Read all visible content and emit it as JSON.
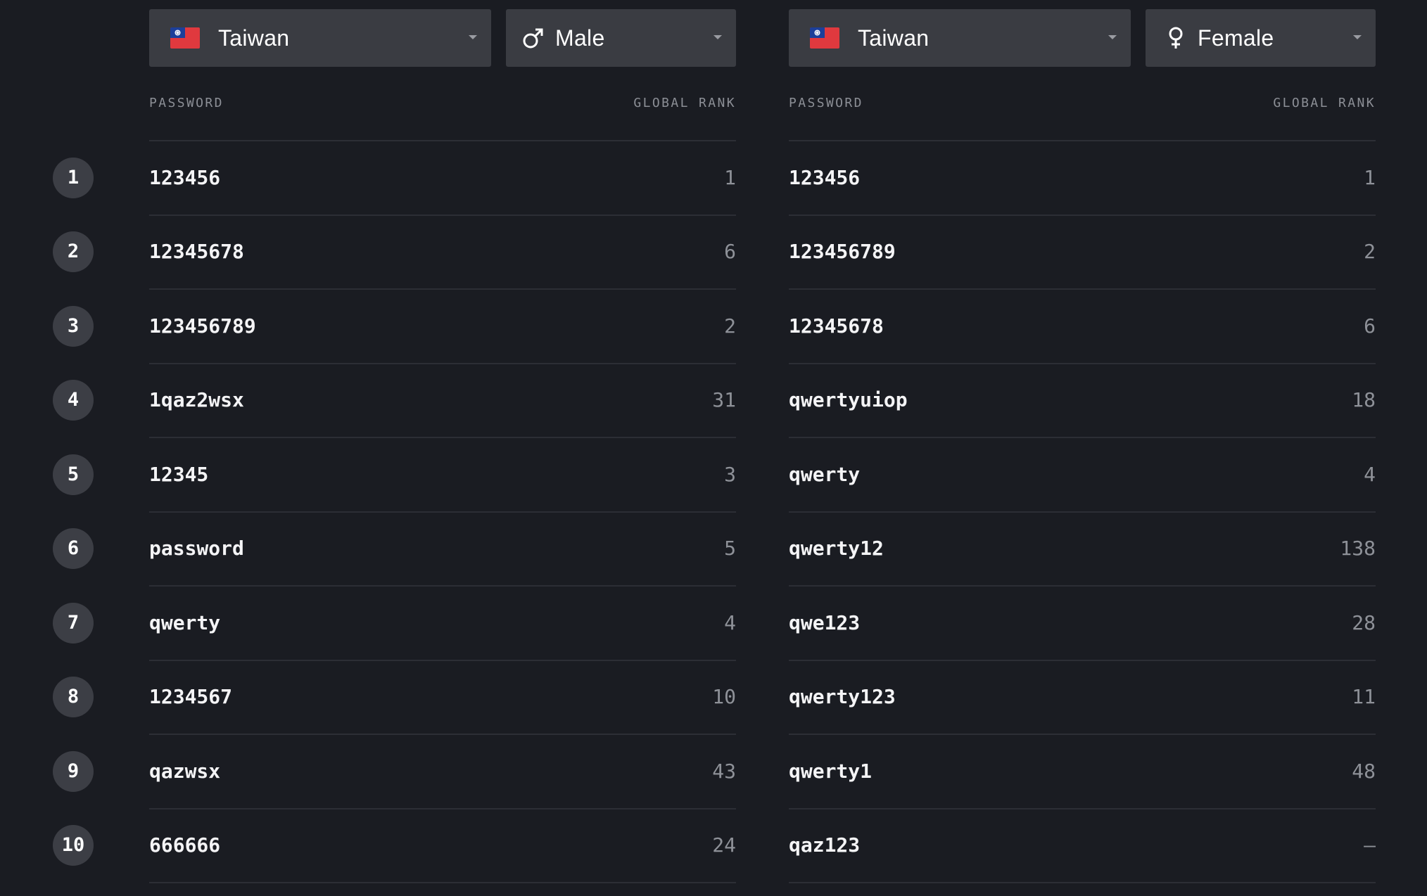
{
  "left": {
    "country": {
      "label": "Taiwan",
      "flag_icon": "taiwan-flag-icon"
    },
    "gender": {
      "label": "Male",
      "icon": "male-icon"
    },
    "headers": {
      "password": "PASSWORD",
      "rank": "GLOBAL RANK"
    },
    "rows": [
      {
        "password": "123456",
        "rank": "1"
      },
      {
        "password": "12345678",
        "rank": "6"
      },
      {
        "password": "123456789",
        "rank": "2"
      },
      {
        "password": "1qaz2wsx",
        "rank": "31"
      },
      {
        "password": "12345",
        "rank": "3"
      },
      {
        "password": "password",
        "rank": "5"
      },
      {
        "password": "qwerty",
        "rank": "4"
      },
      {
        "password": "1234567",
        "rank": "10"
      },
      {
        "password": "qazwsx",
        "rank": "43"
      },
      {
        "password": "666666",
        "rank": "24"
      }
    ]
  },
  "right": {
    "country": {
      "label": "Taiwan",
      "flag_icon": "taiwan-flag-icon"
    },
    "gender": {
      "label": "Female",
      "icon": "female-icon"
    },
    "headers": {
      "password": "PASSWORD",
      "rank": "GLOBAL RANK"
    },
    "rows": [
      {
        "password": "123456",
        "rank": "1"
      },
      {
        "password": "123456789",
        "rank": "2"
      },
      {
        "password": "12345678",
        "rank": "6"
      },
      {
        "password": "qwertyuiop",
        "rank": "18"
      },
      {
        "password": "qwerty",
        "rank": "4"
      },
      {
        "password": "qwerty12",
        "rank": "138"
      },
      {
        "password": "qwe123",
        "rank": "28"
      },
      {
        "password": "qwerty123",
        "rank": "11"
      },
      {
        "password": "qwerty1",
        "rank": "48"
      },
      {
        "password": "qaz123",
        "rank": "–"
      }
    ]
  },
  "ranks": [
    "1",
    "2",
    "3",
    "4",
    "5",
    "6",
    "7",
    "8",
    "9",
    "10"
  ],
  "colors": {
    "background": "#1a1c22",
    "control": "#3a3c42",
    "badge": "#3c3e45",
    "flag_red": "#e0393e",
    "flag_blue": "#1c3f9a"
  }
}
